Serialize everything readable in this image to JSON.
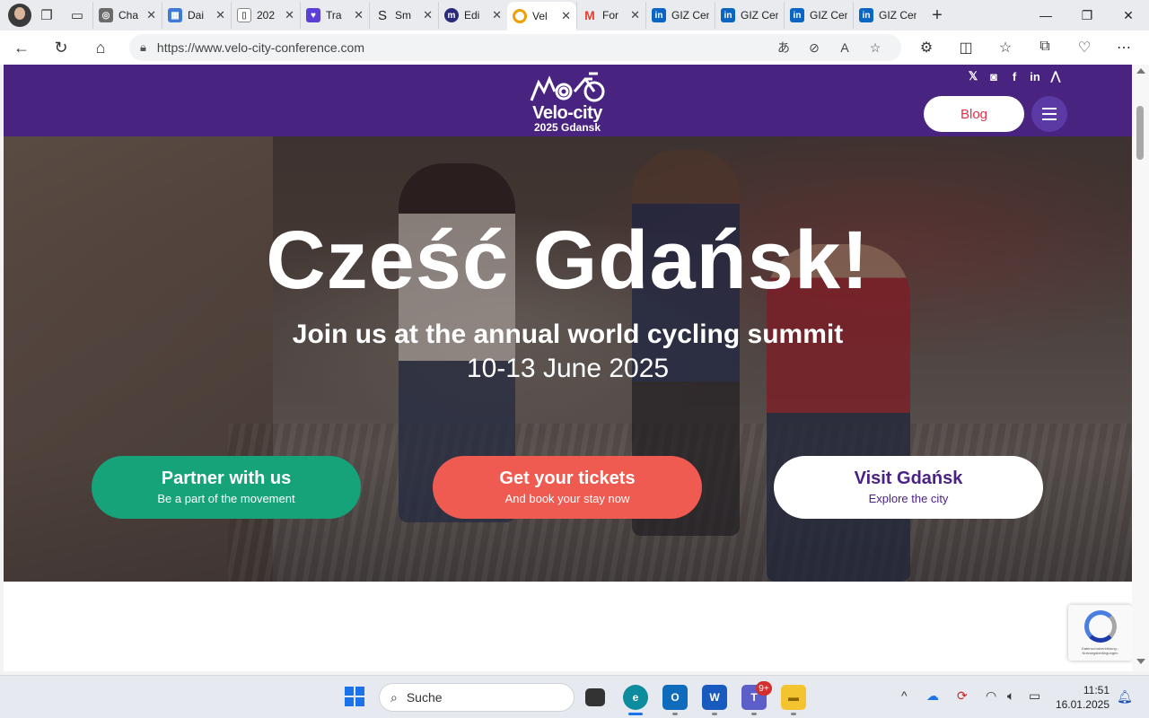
{
  "browser": {
    "tabs": [
      {
        "label": "Cha",
        "icon": "chatgpt-icon",
        "color": "#6b6b6b"
      },
      {
        "label": "Dai",
        "icon": "image-icon",
        "color": "#3d7bd6"
      },
      {
        "label": "202",
        "icon": "document-icon",
        "color": "#888888"
      },
      {
        "label": "Tra",
        "icon": "shield-icon",
        "color": "#5b3fd6"
      },
      {
        "label": "Sm",
        "icon": "s-logo-icon",
        "color": "#222222"
      },
      {
        "label": "Edi",
        "icon": "edit-app-icon",
        "color": "#2a2a7a"
      },
      {
        "label": "Vel",
        "icon": "velo-city-icon",
        "color": "#f0a000"
      },
      {
        "label": "For",
        "icon": "gmail-icon",
        "color": "#e34133"
      },
      {
        "label": "GIZ Cen",
        "icon": "linkedin-icon",
        "color": "#0a66c2"
      },
      {
        "label": "GIZ Cen",
        "icon": "linkedin-icon",
        "color": "#0a66c2"
      },
      {
        "label": "GIZ Cen",
        "icon": "linkedin-icon",
        "color": "#0a66c2"
      },
      {
        "label": "GIZ Cen",
        "icon": "linkedin-icon",
        "color": "#0a66c2"
      }
    ],
    "url": "https://www.velo-city-conference.com"
  },
  "site": {
    "logo_title": "Velo-city",
    "logo_sub": "2025 Gdansk",
    "blog_label": "Blog",
    "headline": "Cześć Gdańsk!",
    "subheadline": "Join us at the annual world cycling summit",
    "dates": "10-13 June 2025",
    "cta": {
      "partner_title": "Partner with us",
      "partner_sub": "Be a part of the movement",
      "tickets_title": "Get your tickets",
      "tickets_sub": "And book your stay now",
      "visit_title": "Visit Gdańsk",
      "visit_sub": "Explore the city"
    },
    "recaptcha_text": "Datenschutzerklärung - Nutzungsbedingungen"
  },
  "taskbar": {
    "search_placeholder": "Suche",
    "teams_badge": "9+",
    "time": "11:51",
    "date": "16.01.2025"
  },
  "colors": {
    "header_purple": "#4a2286",
    "blog_red": "#e3314b",
    "cta_green": "#16a37a",
    "cta_red": "#ef5b50"
  }
}
